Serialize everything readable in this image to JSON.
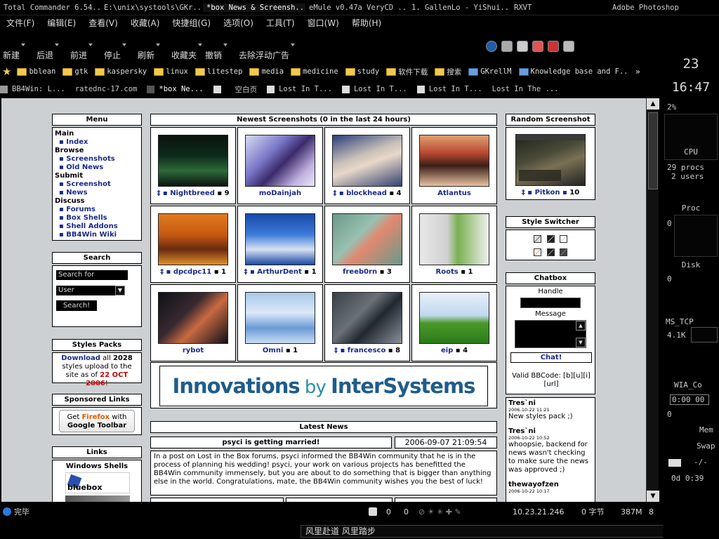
{
  "taskbar": {
    "tasks": [
      "Total Commander 6.54...",
      "E:\\unix\\systools\\GKr...",
      "*box News & Screensh...",
      "eMule v0.47a VeryCD ...",
      "1. GallenLo - YiShui...",
      "RXVT"
    ],
    "right_task": "Adobe Photoshop"
  },
  "menubar": [
    "文件(F)",
    "编辑(E)",
    "查看(V)",
    "收藏(A)",
    "快捷组(G)",
    "选项(O)",
    "工具(T)",
    "窗口(W)",
    "帮助(H)"
  ],
  "toolbar": [
    "新建",
    "后退",
    "前进",
    "停止",
    "刷新",
    "收藏夹",
    "撤销",
    "去除浮动广告"
  ],
  "favorites": [
    "bblean",
    "gtk",
    "kaspersky",
    "linux",
    "litestep",
    "media",
    "medicine",
    "study",
    "软件下载",
    "搜索",
    "GKrellM",
    "Knowledge base and F.."
  ],
  "tabs": [
    "BB4Win: L...",
    "ratednc-17.com",
    "*box Ne...",
    "空白页",
    "Lost In T...",
    "Lost In T...",
    "Lost In T...",
    "Lost In The ..."
  ],
  "page": {
    "menu_title": "Menu",
    "menu": [
      {
        "section": "Main",
        "items": [
          "Index"
        ]
      },
      {
        "section": "Browse",
        "items": [
          "Screenshots",
          "Old News"
        ]
      },
      {
        "section": "Submit",
        "items": [
          "Screenshot",
          "News"
        ]
      },
      {
        "section": "Discuss",
        "items": [
          "Forums",
          "Box Shells",
          "Shell Addons",
          "BB4Win Wiki"
        ]
      }
    ],
    "search_title": "Search",
    "search_for": "Search for",
    "search_type": "User",
    "search_button": "Search!",
    "styles_title": "Styles Packs",
    "styles_text": {
      "download": "Download",
      "all": " all ",
      "count": "2028",
      "mid": " styles upload to the site as of ",
      "date": "22 OCT 2006",
      "end": "!"
    },
    "sponsored_title": "Sponsored Links",
    "firefox": {
      "get": "Get ",
      "firefox": "Firefox",
      "with": " with",
      "line2": "Google Toolbar"
    },
    "links_title": "Links",
    "windows_shells": "Windows Shells",
    "bluebox": "bluebox",
    "newest_title": "Newest Screenshots (0 in the last 24 hours)",
    "screenshots": [
      {
        "name": "Nightbreed",
        "count": "9",
        "star": true
      },
      {
        "name": "moDainjah",
        "count": "",
        "star": false
      },
      {
        "name": "blockhead",
        "count": "4",
        "star": true
      },
      {
        "name": "Atlantus",
        "count": "",
        "star": false
      },
      {
        "name": "dpcdpc11",
        "count": "1",
        "star": true
      },
      {
        "name": "ArthurDent",
        "count": "1",
        "star": true
      },
      {
        "name": "freeb0rn",
        "count": "3",
        "star": false
      },
      {
        "name": "Roots",
        "count": "1",
        "star": false
      },
      {
        "name": "rybot",
        "count": "",
        "star": false
      },
      {
        "name": "Omni",
        "count": "1",
        "star": false
      },
      {
        "name": "francesco",
        "count": "8",
        "star": true
      },
      {
        "name": "eip",
        "count": "4",
        "star": false
      }
    ],
    "ad_text1": "Innovations",
    "ad_text2": " by ",
    "ad_text3": "InterSystems",
    "latest_news_title": "Latest News",
    "news_title": "psyci is getting married!",
    "news_date": "2006-09-07 21:09:54",
    "news_body": "In a post on Lost in the Box forums, psyci informed the BB4Win community that he is in the process of planning his wedding! psyci, your work on various projects has benefitted the BB4Win community immensely, but you are about to do something that is bigger than anything else in the world. Congratulations, mate, the BB4Win community wishes you the best of luck!",
    "random_title": "Random Screenshot",
    "random_name": "Pitkon",
    "random_count": "10",
    "style_switcher_title": "Style Switcher",
    "chatbox_title": "Chatbox",
    "handle_label": "Handle",
    "message_label": "Message",
    "chat_button": "Chat!",
    "bbcode_text": "Valid BBCode: [b][u][i][url]",
    "chat_entries": [
      {
        "user": "Tres`ni",
        "time": "2006-10-22 11:21",
        "msg": "New styles pack ;)"
      },
      {
        "user": "Tres`ni",
        "time": "2006-10-22 10:52",
        "msg": "whoopsie, backend for news wasn't checking to make sure the news was approved ;)"
      },
      {
        "user": "thewayofzen",
        "time": "2006-10-22 10:17",
        "msg": ""
      }
    ]
  },
  "statusbar": {
    "left": "完毕",
    "n0": "0",
    "n1": "0",
    "ip": "10.23.21.246",
    "bytes": "0 字节",
    "mem": "387M",
    "num": "8"
  },
  "ime": "风里赴道  风里踏步",
  "sysmon": {
    "day": "23",
    "time": "16:47",
    "cpu_pct": "2%",
    "cpu": "CPU",
    "procs": "29 procs",
    "users": "2 users",
    "proc": "Proc",
    "proc_val": "0",
    "disk": "Disk",
    "disk_val": "0",
    "net": "MS_TCP",
    "net_val": "4.1K",
    "net2": "WIA_Co",
    "net2_val": "0:00 00",
    "net2_zero": "0",
    "mem": "Mem",
    "swap": "Swap",
    "mail": "-/-",
    "uptime": "0d  0:39"
  },
  "colors": {
    "link": "#1a2a8a",
    "date_red": "#cc0000",
    "ad_blue": "#1f5c8a",
    "ad_teal": "#2a8fa0"
  }
}
